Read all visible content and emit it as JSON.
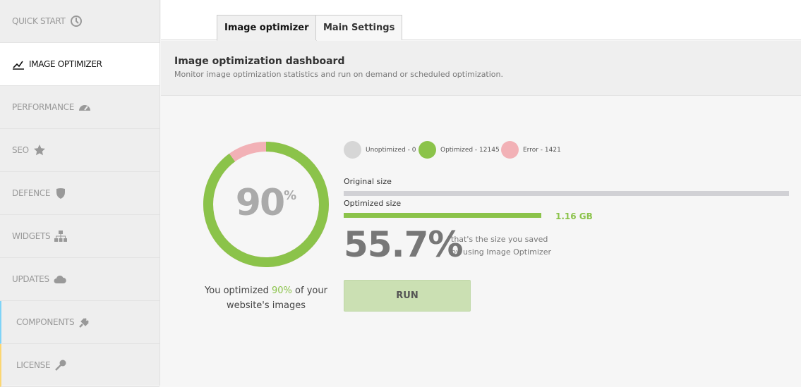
{
  "sidebar": {
    "items": [
      {
        "label": "QUICK START",
        "icon": "clock-icon"
      },
      {
        "label": "IMAGE OPTIMIZER",
        "icon": "chart-line-icon",
        "active": true
      },
      {
        "label": "PERFORMANCE",
        "icon": "speedometer-icon"
      },
      {
        "label": "SEO",
        "icon": "star-icon"
      },
      {
        "label": "DEFENCE",
        "icon": "shield-icon"
      },
      {
        "label": "WIDGETS",
        "icon": "sitemap-icon"
      },
      {
        "label": "UPDATES",
        "icon": "cloud-icon"
      },
      {
        "label": "COMPONENTS",
        "icon": "plug-icon"
      },
      {
        "label": "LICENSE",
        "icon": "key-icon"
      }
    ]
  },
  "tabs": [
    {
      "label": "Image optimizer",
      "active": true
    },
    {
      "label": "Main Settings"
    }
  ],
  "header": {
    "title": "Image optimization dashboard",
    "subtitle": "Monitor image optimization statistics and run on demand or scheduled optimization."
  },
  "donut": {
    "percent": "90",
    "unit": "%",
    "optimized_fraction": 0.9,
    "colors": {
      "optimized": "#8bc34a",
      "error": "#f2b1b6",
      "unoptimized": "#d6d6d6"
    }
  },
  "caption": {
    "before": "You optimized ",
    "value": "90%",
    "after": " of your website's images"
  },
  "legend": [
    {
      "label": "Unoptimized - 0",
      "color": "#d6d6d6"
    },
    {
      "label": "Optimized - 12145",
      "color": "#8bc34a"
    },
    {
      "label": "Error - 1421",
      "color": "#f2b1b6"
    }
  ],
  "sizes": {
    "original_label": "Original size",
    "optimized_label": "Optimized size",
    "optimized_value": "1.16 GB",
    "optimized_fraction": 0.443
  },
  "saved": {
    "percent": "55.7%",
    "line1": "that's the size you saved",
    "line2": "by using Image Optimizer"
  },
  "run_label": "RUN"
}
